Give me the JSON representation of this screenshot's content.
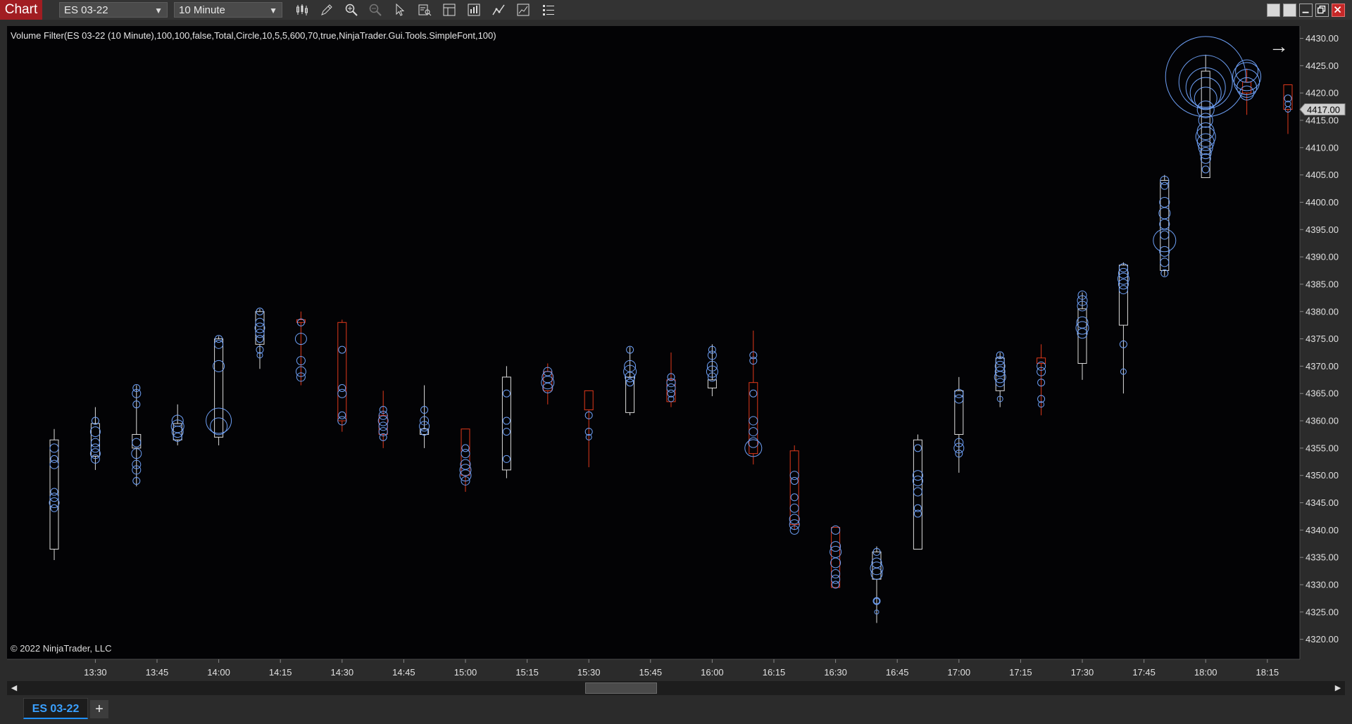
{
  "toolbar": {
    "chart_label": "Chart",
    "instrument": "ES 03-22",
    "interval": "10 Minute",
    "tool_icons": [
      "bar-type-icon",
      "drawing-tool-icon",
      "zoom-in-icon",
      "zoom-out-icon",
      "pointer-icon",
      "data-box-icon",
      "properties-icon",
      "strategies-icon",
      "indicators-icon",
      "templates-icon",
      "chart-trader-icon"
    ]
  },
  "window_buttons": [
    "minimize",
    "restore",
    "maximize",
    "close"
  ],
  "indicator_label": "Volume Filter(ES 03-22 (10 Minute),100,100,false,Total,Circle,10,5,5,600,70,true,NinjaTrader.Gui.Tools.SimpleFont,100)",
  "copyright": "© 2022 NinjaTrader, LLC",
  "tab": {
    "label": "ES 03-22",
    "add": "+"
  },
  "colors": {
    "up": "#dcdcdc",
    "down": "#e0391b",
    "circle": "#6d9ff5",
    "background": "#030305"
  },
  "chart_data": {
    "type": "candlestick",
    "title": "",
    "xlabel": "",
    "ylabel": "",
    "ylim": [
      4317,
      4432
    ],
    "y_ticks": [
      4320,
      4325,
      4330,
      4335,
      4340,
      4345,
      4350,
      4355,
      4360,
      4365,
      4370,
      4375,
      4380,
      4385,
      4390,
      4395,
      4400,
      4405,
      4410,
      4415,
      4420,
      4425,
      4430
    ],
    "x_ticks": [
      "13:30",
      "13:45",
      "14:00",
      "14:15",
      "14:30",
      "14:45",
      "15:00",
      "15:15",
      "15:30",
      "15:45",
      "16:00",
      "16:15",
      "16:30",
      "16:45",
      "17:00",
      "17:15",
      "17:30",
      "17:45",
      "18:00",
      "18:15"
    ],
    "last_price": "4417.00",
    "candles": [
      {
        "time": "13:20",
        "open": 4336.5,
        "high": 4358.5,
        "low": 4334.5,
        "close": 4356.5,
        "circles": [
          [
            4355,
            6
          ],
          [
            4353,
            5
          ],
          [
            4352,
            6
          ],
          [
            4347,
            5
          ],
          [
            4346,
            6
          ],
          [
            4345,
            7
          ],
          [
            4344,
            5
          ]
        ]
      },
      {
        "time": "13:30",
        "open": 4353.5,
        "high": 4362.5,
        "low": 4351,
        "close": 4359.5,
        "circles": [
          [
            4360,
            5
          ],
          [
            4358,
            7
          ],
          [
            4356,
            6
          ],
          [
            4355,
            6
          ],
          [
            4354,
            7
          ],
          [
            4353,
            6
          ]
        ]
      },
      {
        "time": "13:40",
        "open": 4355,
        "high": 4366.5,
        "low": 4348,
        "close": 4357.5,
        "circles": [
          [
            4366,
            5
          ],
          [
            4365,
            6
          ],
          [
            4363,
            5
          ],
          [
            4356,
            6
          ],
          [
            4354,
            7
          ],
          [
            4352,
            6
          ],
          [
            4351,
            6
          ],
          [
            4349,
            5
          ]
        ]
      },
      {
        "time": "13:50",
        "open": 4356.5,
        "high": 4363,
        "low": 4355.5,
        "close": 4359.5,
        "circles": [
          [
            4360,
            8
          ],
          [
            4359,
            9
          ],
          [
            4358,
            8
          ],
          [
            4357,
            6
          ]
        ]
      },
      {
        "time": "14:00",
        "open": 4357,
        "high": 4375.5,
        "low": 4355.5,
        "close": 4375,
        "circles": [
          [
            4375,
            5
          ],
          [
            4374,
            6
          ],
          [
            4370,
            8
          ],
          [
            4360,
            18
          ],
          [
            4359,
            12
          ]
        ]
      },
      {
        "time": "14:10",
        "open": 4374,
        "high": 4380.5,
        "low": 4369.5,
        "close": 4380,
        "circles": [
          [
            4380,
            5
          ],
          [
            4378,
            6
          ],
          [
            4377,
            7
          ],
          [
            4376,
            6
          ],
          [
            4375,
            5
          ],
          [
            4373,
            5
          ],
          [
            4372,
            4
          ]
        ]
      },
      {
        "time": "14:20",
        "open": 4378.5,
        "high": 4380,
        "low": 4366.5,
        "close": 4378,
        "circles": [
          [
            4378,
            5
          ],
          [
            4375,
            8
          ],
          [
            4371,
            6
          ],
          [
            4369,
            7
          ],
          [
            4368,
            6
          ]
        ]
      },
      {
        "time": "14:30",
        "open": 4378,
        "high": 4378.5,
        "low": 4358,
        "close": 4360,
        "circles": [
          [
            4373,
            5
          ],
          [
            4366,
            5
          ],
          [
            4365,
            6
          ],
          [
            4361,
            5
          ],
          [
            4360,
            6
          ]
        ]
      },
      {
        "time": "14:40",
        "open": 4361,
        "high": 4365.5,
        "low": 4355,
        "close": 4357.5,
        "circles": [
          [
            4362,
            5
          ],
          [
            4361,
            6
          ],
          [
            4360,
            7
          ],
          [
            4359,
            6
          ],
          [
            4358,
            6
          ],
          [
            4357,
            5
          ]
        ]
      },
      {
        "time": "14:50",
        "open": 4357.5,
        "high": 4366.5,
        "low": 4355,
        "close": 4358.5,
        "circles": [
          [
            4362,
            5
          ],
          [
            4360,
            6
          ],
          [
            4359,
            7
          ],
          [
            4358,
            5
          ]
        ]
      },
      {
        "time": "15:00",
        "open": 4358.5,
        "high": 4358.5,
        "low": 4347,
        "close": 4350,
        "circles": [
          [
            4355,
            5
          ],
          [
            4354,
            6
          ],
          [
            4352,
            7
          ],
          [
            4351,
            8
          ],
          [
            4350,
            8
          ],
          [
            4349,
            6
          ]
        ]
      },
      {
        "time": "15:10",
        "open": 4351,
        "high": 4370,
        "low": 4349.5,
        "close": 4368,
        "circles": [
          [
            4365,
            5
          ],
          [
            4360,
            5
          ],
          [
            4358,
            5
          ],
          [
            4353,
            5
          ]
        ]
      },
      {
        "time": "15:20",
        "open": 4369,
        "high": 4370.5,
        "low": 4363,
        "close": 4365.5,
        "circles": [
          [
            4369,
            6
          ],
          [
            4368,
            8
          ],
          [
            4367,
            9
          ],
          [
            4366,
            7
          ]
        ]
      },
      {
        "time": "15:30",
        "open": 4365.5,
        "high": 4365.5,
        "low": 4351.5,
        "close": 4362,
        "circles": [
          [
            4361,
            5
          ],
          [
            4358,
            5
          ],
          [
            4357,
            4
          ]
        ]
      },
      {
        "time": "15:40",
        "open": 4361.5,
        "high": 4373.5,
        "low": 4361,
        "close": 4368,
        "circles": [
          [
            4373,
            5
          ],
          [
            4370,
            8
          ],
          [
            4369,
            9
          ],
          [
            4368,
            7
          ],
          [
            4367,
            5
          ]
        ]
      },
      {
        "time": "15:50",
        "open": 4367.5,
        "high": 4372.5,
        "low": 4362.5,
        "close": 4363.5,
        "circles": [
          [
            4368,
            5
          ],
          [
            4367,
            6
          ],
          [
            4366,
            6
          ],
          [
            4365,
            5
          ],
          [
            4364,
            4
          ]
        ]
      },
      {
        "time": "16:00",
        "open": 4366,
        "high": 4374,
        "low": 4364.5,
        "close": 4367.5,
        "circles": [
          [
            4373,
            5
          ],
          [
            4372,
            6
          ],
          [
            4370,
            7
          ],
          [
            4369,
            8
          ],
          [
            4368,
            6
          ]
        ]
      },
      {
        "time": "16:10",
        "open": 4367,
        "high": 4376.5,
        "low": 4352,
        "close": 4354,
        "circles": [
          [
            4372,
            5
          ],
          [
            4371,
            5
          ],
          [
            4365,
            5
          ],
          [
            4360,
            6
          ],
          [
            4358,
            6
          ],
          [
            4356,
            7
          ],
          [
            4355,
            12
          ]
        ]
      },
      {
        "time": "16:20",
        "open": 4354.5,
        "high": 4355.5,
        "low": 4340,
        "close": 4341,
        "circles": [
          [
            4350,
            6
          ],
          [
            4349,
            5
          ],
          [
            4346,
            5
          ],
          [
            4344,
            6
          ],
          [
            4342,
            7
          ],
          [
            4341,
            7
          ],
          [
            4340,
            6
          ]
        ]
      },
      {
        "time": "16:30",
        "open": 4340.5,
        "high": 4340.5,
        "low": 4329.5,
        "close": 4329.5,
        "circles": [
          [
            4340,
            6
          ],
          [
            4337,
            7
          ],
          [
            4336,
            8
          ],
          [
            4334,
            7
          ],
          [
            4332,
            6
          ],
          [
            4331,
            6
          ],
          [
            4330,
            5
          ]
        ]
      },
      {
        "time": "16:40",
        "open": 4331,
        "high": 4337,
        "low": 4323,
        "close": 4336,
        "circles": [
          [
            4336,
            5
          ],
          [
            4334,
            7
          ],
          [
            4333,
            9
          ],
          [
            4332,
            8
          ],
          [
            4327,
            5
          ],
          [
            4327,
            4
          ],
          [
            4325,
            3
          ]
        ]
      },
      {
        "time": "16:50",
        "open": 4336.5,
        "high": 4357.5,
        "low": 4336.5,
        "close": 4356.5,
        "circles": [
          [
            4355,
            5
          ],
          [
            4350,
            7
          ],
          [
            4349,
            7
          ],
          [
            4347,
            6
          ],
          [
            4344,
            5
          ],
          [
            4343,
            5
          ]
        ]
      },
      {
        "time": "17:00",
        "open": 4357.5,
        "high": 4368,
        "low": 4350.5,
        "close": 4365.5,
        "circles": [
          [
            4365,
            6
          ],
          [
            4364,
            6
          ],
          [
            4356,
            6
          ],
          [
            4355,
            7
          ],
          [
            4354,
            5
          ]
        ]
      },
      {
        "time": "17:10",
        "open": 4365.5,
        "high": 4372.5,
        "low": 4362.5,
        "close": 4371.5,
        "circles": [
          [
            4372,
            5
          ],
          [
            4371,
            6
          ],
          [
            4370,
            7
          ],
          [
            4369,
            7
          ],
          [
            4368,
            8
          ],
          [
            4367,
            6
          ],
          [
            4364,
            4
          ]
        ]
      },
      {
        "time": "17:20",
        "open": 4371.5,
        "high": 4374,
        "low": 4361,
        "close": 4370.5,
        "circles": [
          [
            4370,
            6
          ],
          [
            4369,
            6
          ],
          [
            4367,
            5
          ],
          [
            4364,
            5
          ],
          [
            4363,
            4
          ]
        ]
      },
      {
        "time": "17:30",
        "open": 4370.5,
        "high": 4383.5,
        "low": 4367.5,
        "close": 4380.5,
        "circles": [
          [
            4383,
            6
          ],
          [
            4382,
            7
          ],
          [
            4381,
            7
          ],
          [
            4378,
            8
          ],
          [
            4377,
            9
          ],
          [
            4376,
            7
          ]
        ]
      },
      {
        "time": "17:40",
        "open": 4377.5,
        "high": 4389,
        "low": 4365,
        "close": 4388.5,
        "circles": [
          [
            4388,
            6
          ],
          [
            4387,
            7
          ],
          [
            4386,
            8
          ],
          [
            4385,
            7
          ],
          [
            4384,
            6
          ],
          [
            4374,
            5
          ],
          [
            4369,
            4
          ]
        ]
      },
      {
        "time": "17:50",
        "open": 4387.5,
        "high": 4405,
        "low": 4386.5,
        "close": 4404,
        "circles": [
          [
            4404,
            6
          ],
          [
            4403,
            5
          ],
          [
            4400,
            7
          ],
          [
            4398,
            8
          ],
          [
            4396,
            7
          ],
          [
            4394,
            6
          ],
          [
            4393,
            16
          ],
          [
            4391,
            7
          ],
          [
            4389,
            6
          ],
          [
            4387,
            5
          ]
        ]
      },
      {
        "time": "18:00",
        "open": 4404.5,
        "high": 4427,
        "low": 4404.5,
        "close": 4424,
        "circles": [
          [
            4423,
            57
          ],
          [
            4422,
            38
          ],
          [
            4421,
            28
          ],
          [
            4420,
            22
          ],
          [
            4419,
            16
          ],
          [
            4417,
            12
          ],
          [
            4415,
            10
          ],
          [
            4413,
            12
          ],
          [
            4412,
            14
          ],
          [
            4411,
            12
          ],
          [
            4410,
            10
          ],
          [
            4409,
            8
          ],
          [
            4408,
            7
          ],
          [
            4406,
            5
          ]
        ]
      },
      {
        "time": "18:10",
        "open": 4422,
        "high": 4424.5,
        "low": 4416,
        "close": 4420,
        "circles": [
          [
            4424,
            16
          ],
          [
            4423,
            20
          ],
          [
            4422,
            18
          ],
          [
            4421,
            14
          ],
          [
            4420,
            10
          ]
        ]
      },
      {
        "time": "18:20",
        "open": 4421.5,
        "high": 4421.5,
        "low": 4412.5,
        "close": 4417,
        "circles": [
          [
            4419,
            5
          ],
          [
            4418,
            4
          ],
          [
            4417,
            4
          ]
        ]
      }
    ]
  }
}
